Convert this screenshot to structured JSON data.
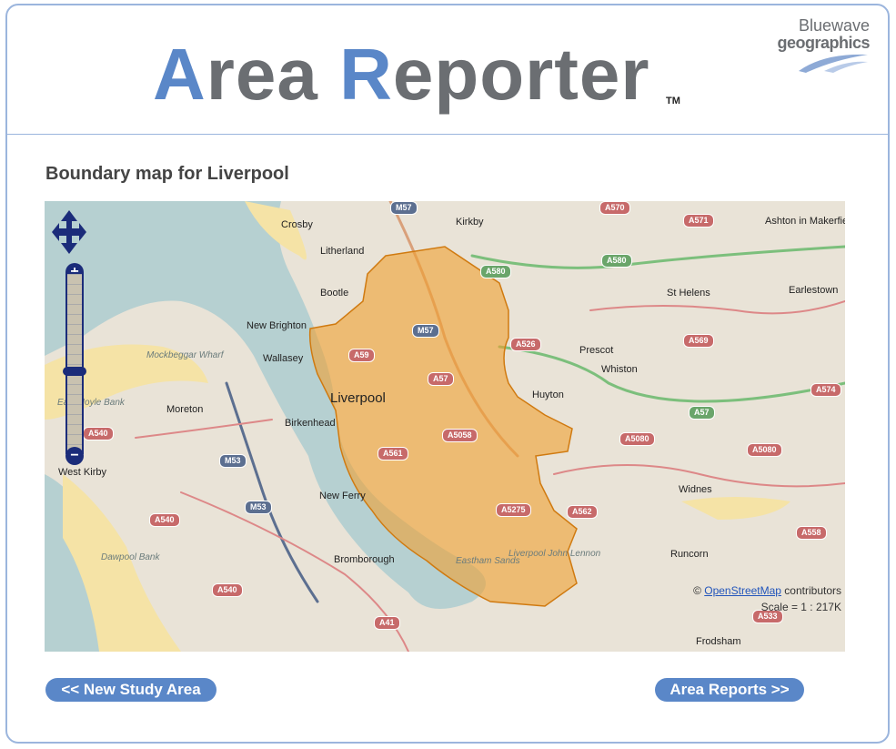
{
  "header": {
    "title_first_cap": "A",
    "title_first_rest": "rea ",
    "title_second_cap": "R",
    "title_second_rest": "eporter",
    "trademark": "TM",
    "logo_top": "Bluewave",
    "logo_bottom": "geographics"
  },
  "page": {
    "heading": "Boundary map for Liverpool"
  },
  "map": {
    "colors": {
      "sea": "#b6d0d1",
      "land": "#e9e3d7",
      "sand": "#f5e3a6",
      "boundary_fill": "#f0a030",
      "boundary_stroke": "#d07a10",
      "nav": "#1b2c7a"
    },
    "places": [
      {
        "name": "Crosby"
      },
      {
        "name": "Litherland"
      },
      {
        "name": "Kirkby"
      },
      {
        "name": "Bootle"
      },
      {
        "name": "New Brighton"
      },
      {
        "name": "Wallasey"
      },
      {
        "name": "Liverpool"
      },
      {
        "name": "Moreton"
      },
      {
        "name": "Birkenhead"
      },
      {
        "name": "West Kirby"
      },
      {
        "name": "New Ferry"
      },
      {
        "name": "Bromborough"
      },
      {
        "name": "St Helens"
      },
      {
        "name": "Prescot"
      },
      {
        "name": "Whiston"
      },
      {
        "name": "Huyton"
      },
      {
        "name": "Earlestown"
      },
      {
        "name": "Widnes"
      },
      {
        "name": "Runcorn"
      },
      {
        "name": "Frodsham"
      },
      {
        "name": "Ashton in Makerfie"
      }
    ],
    "water_labels": [
      {
        "name": "Mockbeggar Wharf"
      },
      {
        "name": "East Hoyle Bank"
      },
      {
        "name": "Dawpool Bank"
      },
      {
        "name": "Eastham Sands"
      },
      {
        "name": "Liverpool John Lennon"
      }
    ],
    "roads": [
      {
        "ref": "M57"
      },
      {
        "ref": "A570"
      },
      {
        "ref": "A571"
      },
      {
        "ref": "A580"
      },
      {
        "ref": "A580"
      },
      {
        "ref": "M57"
      },
      {
        "ref": "A59"
      },
      {
        "ref": "A57"
      },
      {
        "ref": "A526"
      },
      {
        "ref": "A569"
      },
      {
        "ref": "A574"
      },
      {
        "ref": "A57"
      },
      {
        "ref": "A5058"
      },
      {
        "ref": "A561"
      },
      {
        "ref": "A540"
      },
      {
        "ref": "M53"
      },
      {
        "ref": "M53"
      },
      {
        "ref": "A5080"
      },
      {
        "ref": "A5080"
      },
      {
        "ref": "A540"
      },
      {
        "ref": "A5275"
      },
      {
        "ref": "A562"
      },
      {
        "ref": "A558"
      },
      {
        "ref": "A540"
      },
      {
        "ref": "A41"
      },
      {
        "ref": "A533"
      }
    ],
    "zoom_level": 0.55,
    "attribution_prefix": "© ",
    "attribution_link": "OpenStreetMap",
    "attribution_suffix": " contributors",
    "scale": "Scale = 1 : 217K"
  },
  "buttons": {
    "new_study": "<< New Study Area",
    "reports": "Area Reports >>"
  }
}
